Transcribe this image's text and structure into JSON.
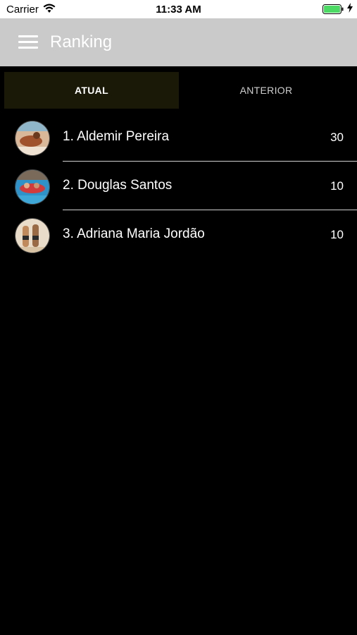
{
  "status_bar": {
    "carrier": "Carrier",
    "time": "11:33 AM",
    "battery_color": "#4cd964"
  },
  "nav": {
    "title": "Ranking",
    "background": "#cacaca"
  },
  "tabs": [
    {
      "label": "ATUAL",
      "active": true
    },
    {
      "label": "ANTERIOR",
      "active": false
    }
  ],
  "ranking": [
    {
      "position_name": "1. Aldemir Pereira",
      "points": "30",
      "avatar": "photo-avatar"
    },
    {
      "position_name": "2. Douglas Santos",
      "points": "10",
      "avatar": "photo-avatar"
    },
    {
      "position_name": "3. Adriana Maria Jordão",
      "points": "10",
      "avatar": "photo-avatar"
    }
  ]
}
